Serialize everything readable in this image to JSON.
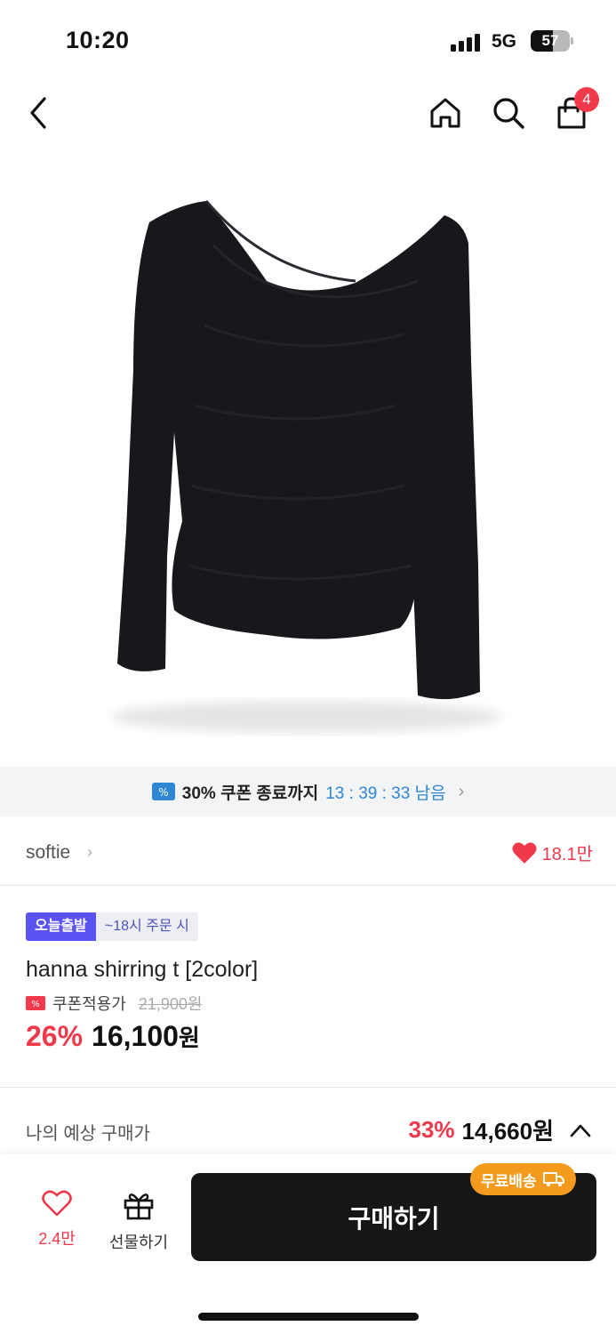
{
  "status_bar": {
    "time": "10:20",
    "network": "5G",
    "battery": "57",
    "battery_level": 0.57
  },
  "nav": {
    "back_icon": "chevron-left-icon",
    "home_icon": "home-icon",
    "search_icon": "search-icon",
    "cart_icon": "shopping-bag-icon",
    "cart_count": "4"
  },
  "product_image": {
    "icon": "black-long-sleeve-top-photo"
  },
  "coupon_banner": {
    "label": "30% 쿠폰 종료까지",
    "timer": "13 : 39 : 33 남음",
    "icon": "coupon-icon"
  },
  "seller": {
    "name": "softie",
    "likes": "18.1만"
  },
  "product": {
    "tag_today": "오늘출발",
    "tag_order": "~18시 주문 시",
    "title": "hanna shirring t [2color]",
    "coupon_label": "쿠폰적용가",
    "original_price": "21,900원",
    "discount": "26%",
    "price": "16,100",
    "won": "원"
  },
  "expected_price": {
    "label": "나의 예상 구매가",
    "discount": "33%",
    "price": "14,660원"
  },
  "bottom_bar": {
    "wish_count": "2.4만",
    "gift_label": "선물하기",
    "buy_label": "구매하기",
    "free_shipping": "무료배송"
  },
  "colors": {
    "accent_red": "#f0394b",
    "today_tag": "#5b53f1",
    "timer_blue": "#2f86d4",
    "free_ship_orange": "#f49a1c",
    "buy_button": "#161616"
  }
}
